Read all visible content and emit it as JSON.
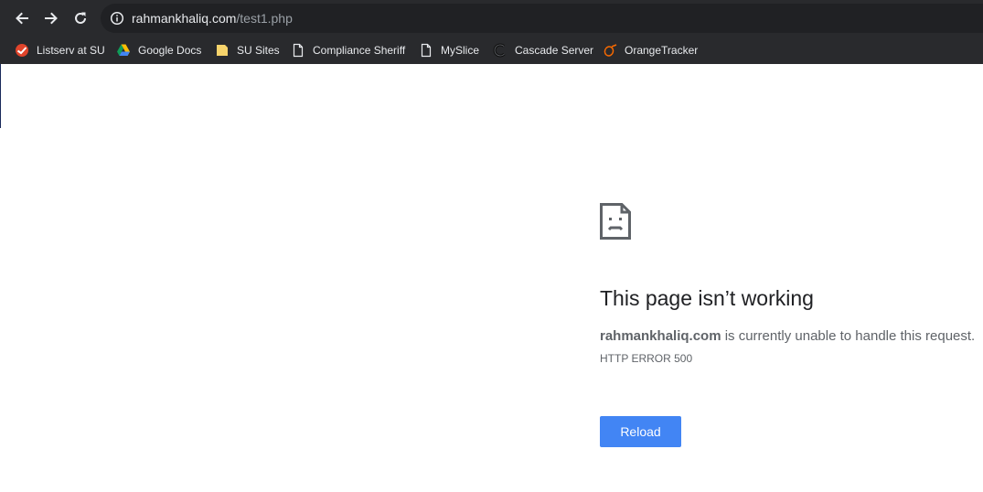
{
  "toolbar": {
    "back_icon": "back-arrow-icon",
    "forward_icon": "forward-arrow-icon",
    "reload_icon": "reload-icon"
  },
  "omnibox": {
    "info_icon": "info-icon",
    "url_host": "rahmankhaliq.com",
    "url_path": "/test1.php"
  },
  "bookmarks": [
    {
      "label": "Listserv at SU",
      "icon": "listserv-icon"
    },
    {
      "label": "Google Docs",
      "icon": "google-drive-icon"
    },
    {
      "label": "SU Sites",
      "icon": "folder-icon"
    },
    {
      "label": "Compliance Sheriff",
      "icon": "page-icon"
    },
    {
      "label": "MySlice",
      "icon": "page-icon"
    },
    {
      "label": "Cascade Server",
      "icon": "cascade-icon"
    },
    {
      "label": "OrangeTracker",
      "icon": "orangetracker-icon"
    }
  ],
  "error": {
    "icon": "sad-page-icon",
    "title": "This page isn’t working",
    "host": "rahmankhaliq.com",
    "message": " is currently unable to handle this request.",
    "code": "HTTP ERROR 500",
    "reload_label": "Reload"
  },
  "colors": {
    "chrome_bg": "#292a2d",
    "omnibox_bg": "#202124",
    "button_blue": "#4285f4",
    "title_text": "#202124",
    "body_text": "#5f6368"
  }
}
